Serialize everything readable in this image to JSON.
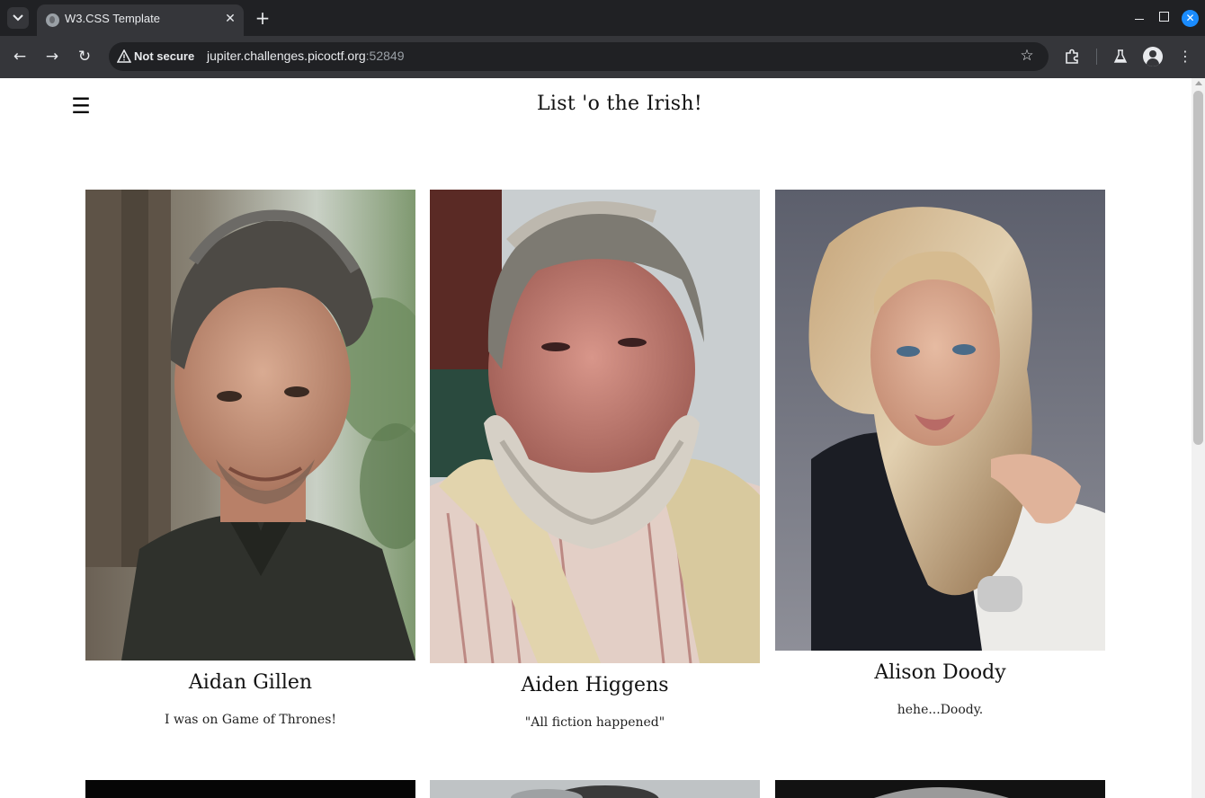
{
  "browser": {
    "tab_title": "W3.CSS Template",
    "security_label": "Not secure",
    "url_host": "jupiter.challenges.picoctf.org",
    "url_port": ":52849",
    "accent_color": "#1a8cff"
  },
  "page": {
    "title": "List 'o the Irish!",
    "menu_icon": "hamburger-menu-icon",
    "cards": [
      {
        "name": "Aidan Gillen",
        "quote": "I was on Game of Thrones!"
      },
      {
        "name": "Aiden Higgens",
        "quote": "\"All fiction happened\""
      },
      {
        "name": "Alison Doody",
        "quote": "hehe...Doody."
      }
    ]
  }
}
